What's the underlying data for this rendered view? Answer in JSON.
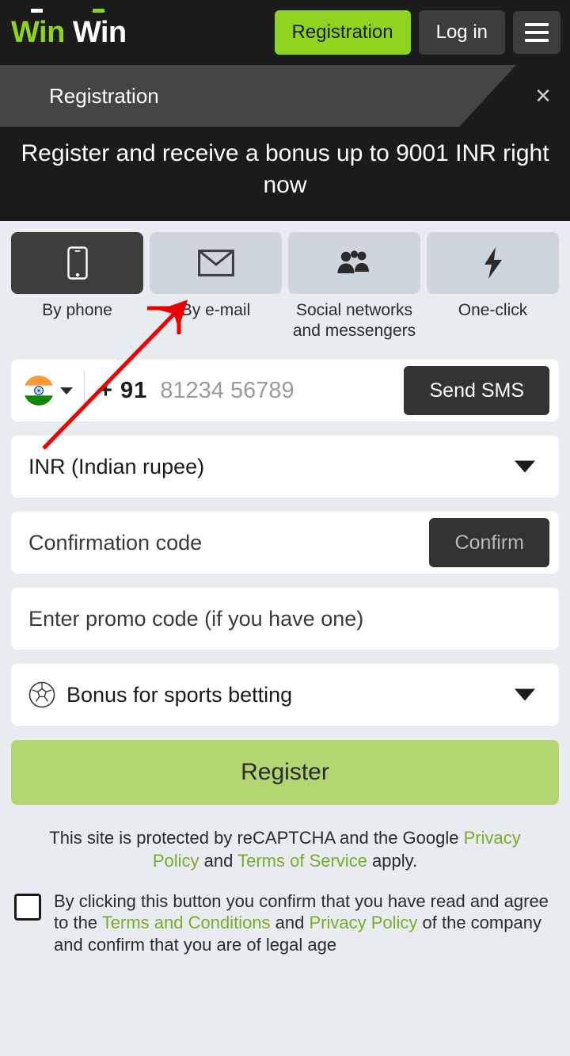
{
  "header": {
    "logo": {
      "part1": "Win",
      "part2": "Win"
    },
    "registration_label": "Registration",
    "login_label": "Log in",
    "menu_icon": "hamburger-menu-icon"
  },
  "modal": {
    "title": "Registration",
    "close_label": "×",
    "banner": "Register and receive a bonus up to 9001 INR right now"
  },
  "methods": [
    {
      "label": "By phone",
      "icon": "smartphone-icon",
      "active": true
    },
    {
      "label": "By e-mail",
      "icon": "envelope-icon",
      "active": false
    },
    {
      "label": "Social networks and messengers",
      "icon": "people-group-icon",
      "active": false
    },
    {
      "label": "One-click",
      "icon": "lightning-bolt-icon",
      "active": false
    }
  ],
  "form": {
    "phone": {
      "flag_icon": "india-flag-icon",
      "country_code": "+ 91",
      "value": "",
      "placeholder": "81234 56789",
      "send_sms_label": "Send SMS"
    },
    "currency": {
      "value": "INR (Indian rupee)",
      "caret_icon": "chevron-down-icon"
    },
    "confirmation": {
      "value": "",
      "placeholder": "Confirmation code",
      "confirm_label": "Confirm"
    },
    "promo": {
      "value": "",
      "placeholder": "Enter promo code (if you have one)"
    },
    "bonus": {
      "icon": "soccer-ball-icon",
      "value": "Bonus for sports betting",
      "caret_icon": "chevron-down-icon"
    },
    "register_label": "Register"
  },
  "footer": {
    "recaptcha_prefix": "This site is protected by reCAPTCHA and the Google ",
    "privacy_policy": "Privacy Policy",
    "recaptcha_and": " and ",
    "terms_of_service": "Terms of Service",
    "recaptcha_suffix": " apply.",
    "terms_part1": "By clicking this button you confirm that you have read and agree to the ",
    "terms_and_conditions": "Terms and Conditions",
    "terms_part2": " and ",
    "terms_privacy": "Privacy Policy",
    "terms_part3": " of the company and confirm that you are of legal age",
    "checkbox_checked": false
  },
  "annotation": {
    "arrow_color": "#ee0000",
    "points_to": "By e-mail"
  },
  "colors": {
    "brand_green": "#8ed41f",
    "register_green": "#b2d471",
    "link_green": "#7aab2a",
    "dark": "#1b1b1b",
    "page_bg": "#e8ecf0",
    "tile_inactive": "#ced5dc",
    "tile_active": "#3d3d3d"
  }
}
